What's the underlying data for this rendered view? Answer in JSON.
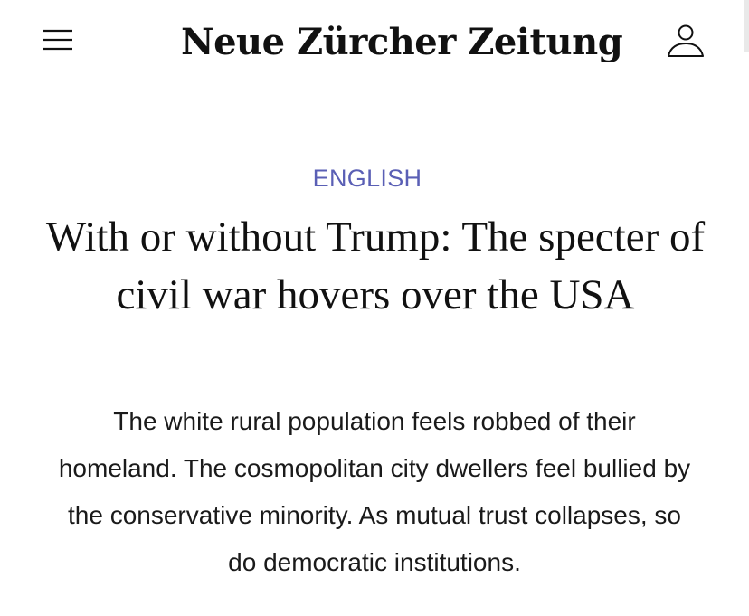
{
  "header": {
    "logo_text": "Neue Zürcher Zeitung",
    "menu_icon": "hamburger-menu-icon",
    "account_icon": "user-account-icon"
  },
  "article": {
    "section_label": "ENGLISH",
    "headline": "With or without Trump: The specter of civil war hovers over the USA",
    "lead": "The white rural population feels robbed of their homeland. The cosmopolitan city dwellers feel bullied by the conservative minority. As mutual trust collapses, so do democratic institutions."
  },
  "colors": {
    "section_label": "#5a5fb5",
    "text": "#111111",
    "background": "#ffffff"
  }
}
